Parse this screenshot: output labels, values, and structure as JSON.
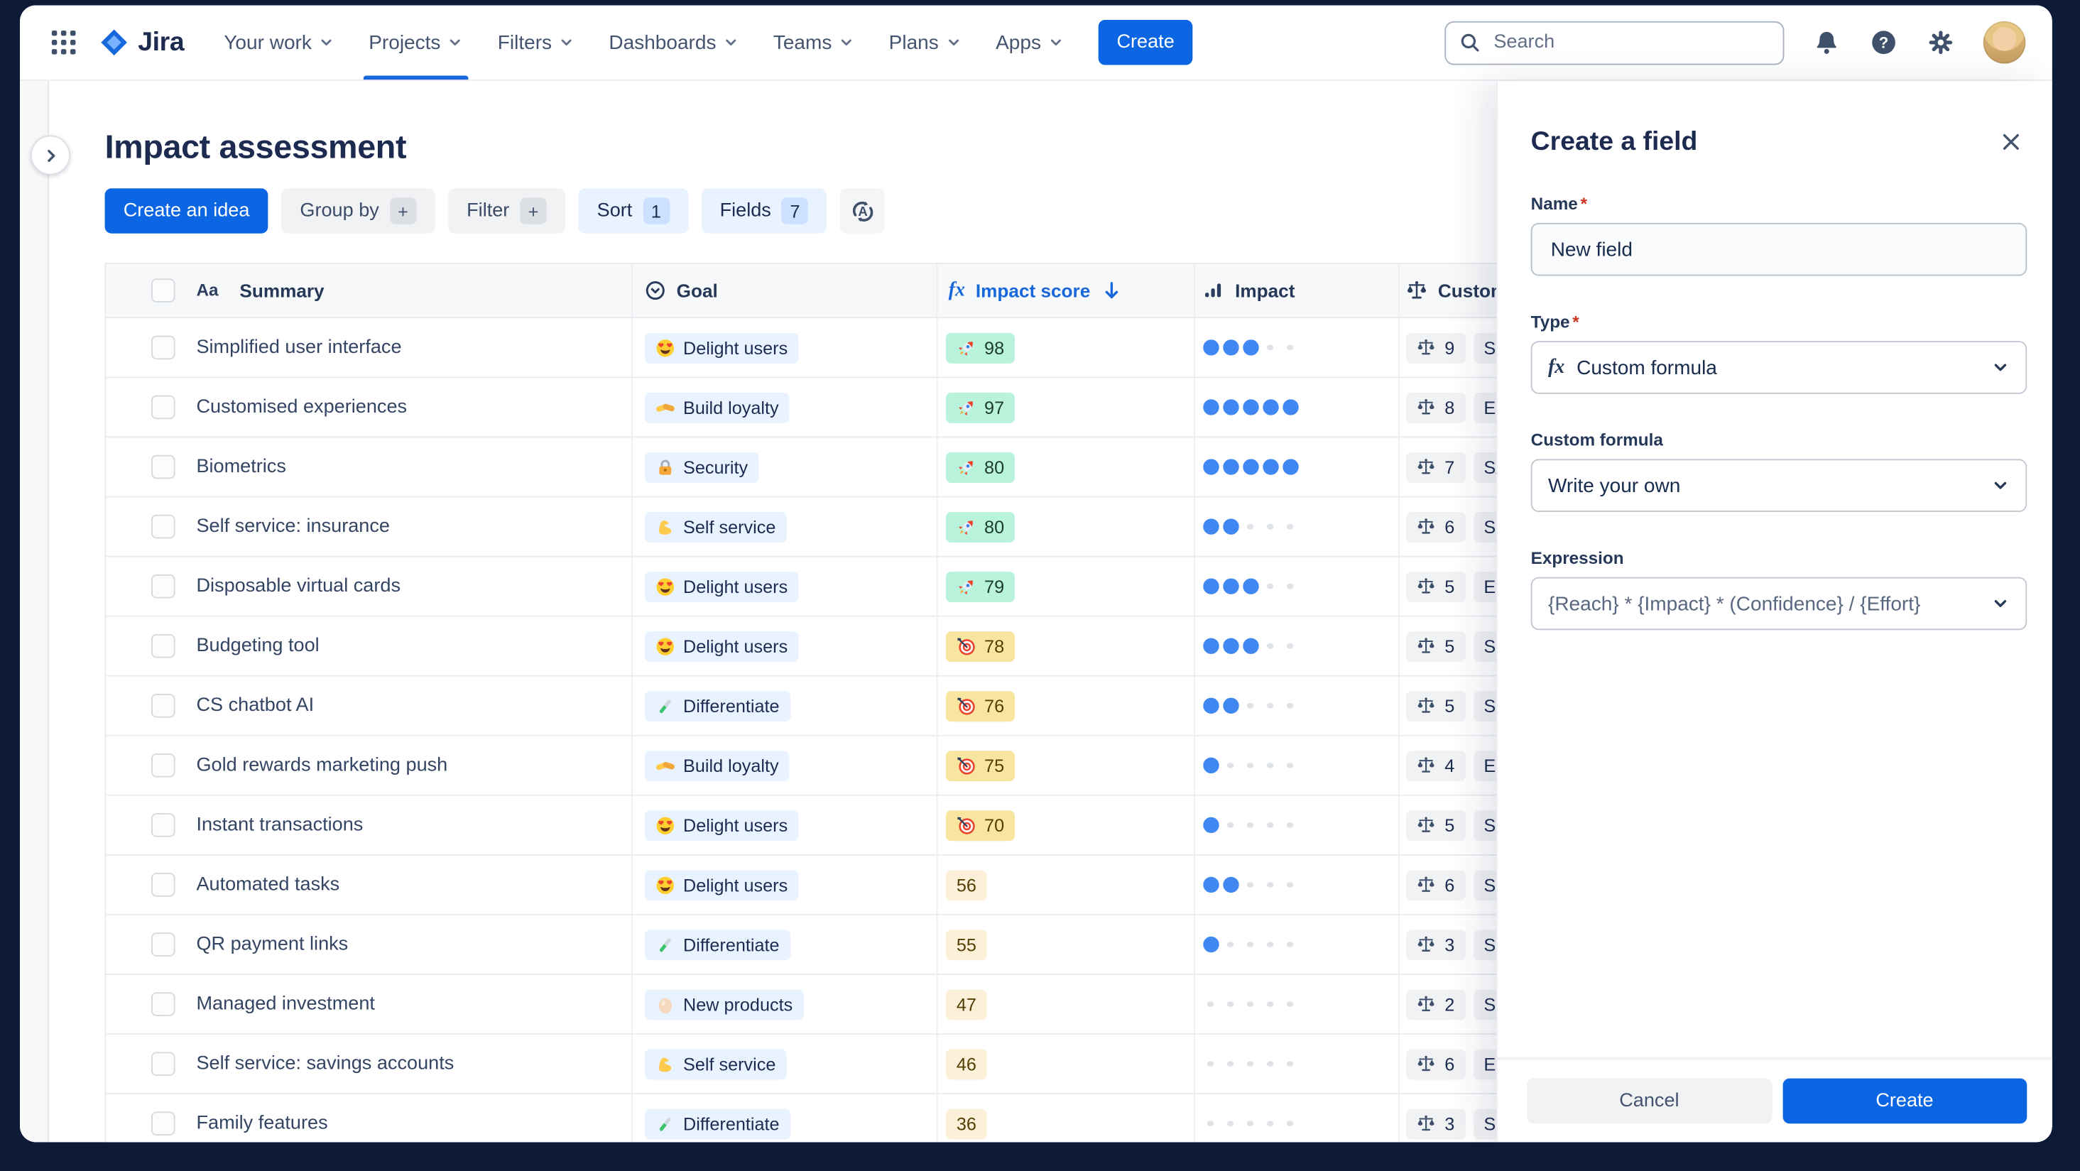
{
  "navbar": {
    "logo_text": "Jira",
    "items": [
      {
        "label": "Your work",
        "active": false
      },
      {
        "label": "Projects",
        "active": true
      },
      {
        "label": "Filters",
        "active": false
      },
      {
        "label": "Dashboards",
        "active": false
      },
      {
        "label": "Teams",
        "active": false
      },
      {
        "label": "Plans",
        "active": false
      },
      {
        "label": "Apps",
        "active": false
      }
    ],
    "create_label": "Create",
    "search_placeholder": "Search",
    "right_icons": [
      "notification-bell-icon",
      "help-icon",
      "settings-gear-icon",
      "user-avatar"
    ]
  },
  "page": {
    "title": "Impact assessment",
    "toolbar": {
      "create_idea_label": "Create an idea",
      "group_by_label": "Group by",
      "group_by_badge": "+",
      "filter_label": "Filter",
      "filter_badge": "+",
      "sort_label": "Sort",
      "sort_badge": "1",
      "fields_label": "Fields",
      "fields_badge": "7",
      "rank_icon": "auto-sort-a-icon"
    }
  },
  "table": {
    "columns": [
      {
        "label": "Summary",
        "icon": "text-field-icon"
      },
      {
        "label": "Goal",
        "icon": "select-field-icon"
      },
      {
        "label": "Impact score",
        "icon": "formula-icon",
        "sort": "desc"
      },
      {
        "label": "Impact",
        "icon": "bar-chart-icon"
      },
      {
        "label": "Customer",
        "icon": "scales-icon"
      }
    ],
    "rows": [
      {
        "summary": "Simplified user interface",
        "goal": {
          "icon": "heart-eyes-emoji",
          "emoji": "😍",
          "label": "Delight users"
        },
        "score": {
          "value": "98",
          "tier": "green",
          "icon": "rocket-emoji",
          "emoji": "🚀"
        },
        "impact": 3,
        "customer": {
          "count": "9",
          "label": "SMB"
        }
      },
      {
        "summary": "Customised experiences",
        "goal": {
          "icon": "handshake-emoji",
          "emoji": "🤝",
          "label": "Build loyalty"
        },
        "score": {
          "value": "97",
          "tier": "green",
          "icon": "rocket-emoji",
          "emoji": "🚀"
        },
        "impact": 5,
        "customer": {
          "count": "8",
          "label": "Enterprise"
        }
      },
      {
        "summary": "Biometrics",
        "goal": {
          "icon": "lock-emoji",
          "emoji": "🔒",
          "label": "Security"
        },
        "score": {
          "value": "80",
          "tier": "green",
          "icon": "rocket-emoji",
          "emoji": "🚀"
        },
        "impact": 5,
        "customer": {
          "count": "7",
          "label": "SAAS"
        }
      },
      {
        "summary": "Self service: insurance",
        "goal": {
          "icon": "muscle-emoji",
          "emoji": "💪",
          "label": "Self service"
        },
        "score": {
          "value": "80",
          "tier": "green",
          "icon": "rocket-emoji",
          "emoji": "🚀"
        },
        "impact": 2,
        "customer": {
          "count": "6",
          "label": "SMB"
        }
      },
      {
        "summary": "Disposable virtual cards",
        "goal": {
          "icon": "heart-eyes-emoji",
          "emoji": "😍",
          "label": "Delight users"
        },
        "score": {
          "value": "79",
          "tier": "green",
          "icon": "rocket-emoji",
          "emoji": "🚀"
        },
        "impact": 3,
        "customer": {
          "count": "5",
          "label": "Enterprise"
        }
      },
      {
        "summary": "Budgeting tool",
        "goal": {
          "icon": "heart-eyes-emoji",
          "emoji": "😍",
          "label": "Delight users"
        },
        "score": {
          "value": "78",
          "tier": "yellow",
          "icon": "target-emoji",
          "emoji": "🎯"
        },
        "impact": 3,
        "customer": {
          "count": "5",
          "label": "Scaleup"
        }
      },
      {
        "summary": "CS chatbot AI",
        "goal": {
          "icon": "test-tube-emoji",
          "emoji": "🧪",
          "label": "Differentiate"
        },
        "score": {
          "value": "76",
          "tier": "yellow",
          "icon": "target-emoji",
          "emoji": "🎯"
        },
        "impact": 2,
        "customer": {
          "count": "5",
          "label": "SMB"
        }
      },
      {
        "summary": "Gold rewards marketing push",
        "goal": {
          "icon": "handshake-emoji",
          "emoji": "🤝",
          "label": "Build loyalty"
        },
        "score": {
          "value": "75",
          "tier": "yellow",
          "icon": "target-emoji",
          "emoji": "🎯"
        },
        "impact": 1,
        "customer": {
          "count": "4",
          "label": "Enterprise"
        }
      },
      {
        "summary": "Instant transactions",
        "goal": {
          "icon": "heart-eyes-emoji",
          "emoji": "😍",
          "label": "Delight users"
        },
        "score": {
          "value": "70",
          "tier": "yellow",
          "icon": "target-emoji",
          "emoji": "🎯"
        },
        "impact": 1,
        "customer": {
          "count": "5",
          "label": "SMB"
        }
      },
      {
        "summary": "Automated tasks",
        "goal": {
          "icon": "heart-eyes-emoji",
          "emoji": "😍",
          "label": "Delight users"
        },
        "score": {
          "value": "56",
          "tier": "plain",
          "icon": null
        },
        "impact": 2,
        "customer": {
          "count": "6",
          "label": "SMB"
        }
      },
      {
        "summary": "QR payment links",
        "goal": {
          "icon": "test-tube-emoji",
          "emoji": "🧪",
          "label": "Differentiate"
        },
        "score": {
          "value": "55",
          "tier": "plain",
          "icon": null
        },
        "impact": 1,
        "customer": {
          "count": "3",
          "label": "SMB"
        }
      },
      {
        "summary": "Managed investment",
        "goal": {
          "icon": "egg-emoji",
          "emoji": "🥚",
          "label": "New products"
        },
        "score": {
          "value": "47",
          "tier": "plain",
          "icon": null
        },
        "impact": 0,
        "customer": {
          "count": "2",
          "label": "SMB"
        }
      },
      {
        "summary": "Self service: savings accounts",
        "goal": {
          "icon": "muscle-emoji",
          "emoji": "💪",
          "label": "Self service"
        },
        "score": {
          "value": "46",
          "tier": "plain",
          "icon": null
        },
        "impact": 0,
        "customer": {
          "count": "6",
          "label": "Enterprise"
        }
      },
      {
        "summary": "Family features",
        "goal": {
          "icon": "test-tube-emoji",
          "emoji": "🧪",
          "label": "Differentiate"
        },
        "score": {
          "value": "36",
          "tier": "plain",
          "icon": null
        },
        "impact": 0,
        "customer": {
          "count": "3",
          "label": "SMB"
        }
      }
    ]
  },
  "panel": {
    "title": "Create a field",
    "name_label": "Name",
    "name_value": "New field",
    "type_label": "Type",
    "type_value": "Custom formula",
    "type_icon": "formula-icon",
    "custom_formula_label": "Custom formula",
    "custom_formula_value": "Write your own",
    "expression_label": "Expression",
    "expression_value": "{Reach} * {Impact} * (Confidence} / {Effort}",
    "cancel_label": "Cancel",
    "create_label": "Create"
  },
  "colors": {
    "frame_bg": "#0D1A38",
    "primary_blue": "#0C66E4",
    "link_blue": "#1868DB",
    "heading": "#1D2B50",
    "goal_pill_bg": "#E9F2FF",
    "score_green_bg": "#BAF3DB",
    "score_yellow_bg": "#F8E6A0",
    "score_plain_bg": "#FDF0D8",
    "impact_dot": "#4187F1",
    "segment_pill_bg": "#F1F2F4",
    "required_asterisk": "#CA3521"
  }
}
